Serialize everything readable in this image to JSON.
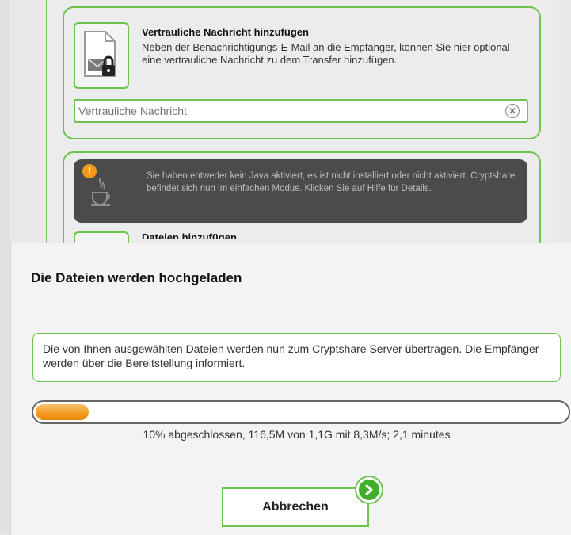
{
  "message_section": {
    "title": "Vertrauliche Nachricht hinzufügen",
    "description": "Neben der Benachrichtigungs-E-Mail an die Empfänger, können Sie hier optional eine vertrauliche Nachricht zu dem Transfer hinzufügen.",
    "input_placeholder": "Vertrauliche Nachricht",
    "input_value": ""
  },
  "java_warning": {
    "text": "Sie haben entweder kein Java aktiviert, es ist nicht installiert oder nicht aktiviert. Cryptshare befindet sich nun im einfachen Modus. Klicken Sie auf Hilfe für Details."
  },
  "files_section": {
    "title": "Dateien hinzufügen"
  },
  "upload_dialog": {
    "title": "Die Dateien werden hochgeladen",
    "info_text": "Die von Ihnen ausgewählten Dateien werden nun zum Cryptshare Server übertragen. Die Empfänger werden über die Bereitstellung informiert.",
    "progress_percent": 10,
    "progress_text": "10% abgeschlossen, 116,5M von 1,1G mit 8,3M/s; 2,1 minutes",
    "cancel_label": "Abbrechen"
  },
  "colors": {
    "accent_green": "#6cc44f",
    "progress_orange": "#f39a1e",
    "warning_bg": "#4b4b4b"
  },
  "icons": [
    "envelope-lock-icon",
    "clear-icon",
    "warning-icon",
    "java-icon",
    "arrow-right-icon"
  ]
}
